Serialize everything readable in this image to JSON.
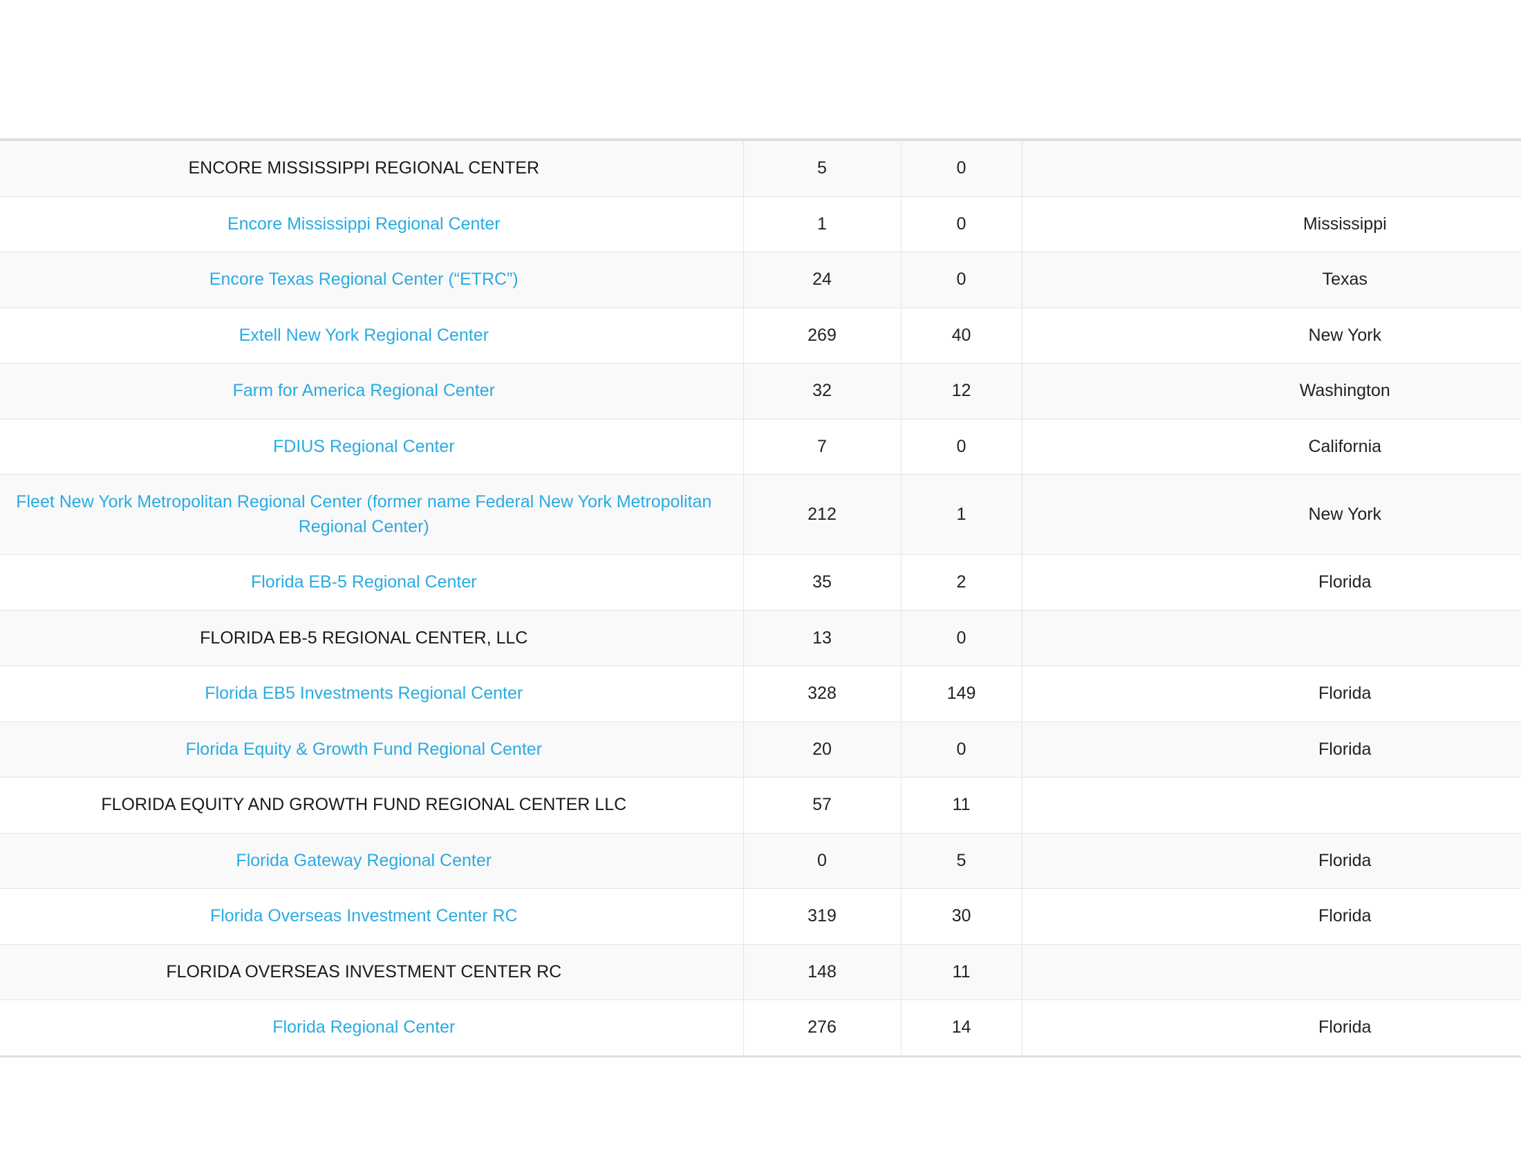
{
  "table": {
    "columns": [
      {
        "key": "name",
        "align": "center"
      },
      {
        "key": "col_a",
        "align": "center"
      },
      {
        "key": "col_b",
        "align": "center"
      },
      {
        "key": "state",
        "align": "center"
      }
    ],
    "accent_link_color": "#29abe2",
    "stripe_color": "#f9f9f9",
    "border_color": "#e4e4e4",
    "rows": [
      {
        "name": "ENCORE MISSISSIPPI REGIONAL CENTER",
        "is_link": false,
        "col_a": "5",
        "col_b": "0",
        "state": ""
      },
      {
        "name": "Encore Mississippi Regional Center",
        "is_link": true,
        "col_a": "1",
        "col_b": "0",
        "state": "Mississippi"
      },
      {
        "name": "Encore Texas Regional Center (“ETRC”)",
        "is_link": true,
        "col_a": "24",
        "col_b": "0",
        "state": "Texas"
      },
      {
        "name": "Extell New York Regional Center",
        "is_link": true,
        "col_a": "269",
        "col_b": "40",
        "state": "New York"
      },
      {
        "name": "Farm for America Regional Center",
        "is_link": true,
        "col_a": "32",
        "col_b": "12",
        "state": "Washington"
      },
      {
        "name": "FDIUS Regional Center",
        "is_link": true,
        "col_a": "7",
        "col_b": "0",
        "state": "California"
      },
      {
        "name": "Fleet New York Metropolitan Regional Center (former name Federal New York Metropolitan Regional Center)",
        "is_link": true,
        "col_a": "212",
        "col_b": "1",
        "state": "New York"
      },
      {
        "name": "Florida EB-5 Regional Center",
        "is_link": true,
        "col_a": "35",
        "col_b": "2",
        "state": "Florida"
      },
      {
        "name": "FLORIDA EB-5 REGIONAL CENTER, LLC",
        "is_link": false,
        "col_a": "13",
        "col_b": "0",
        "state": ""
      },
      {
        "name": "Florida EB5 Investments Regional Center",
        "is_link": true,
        "col_a": "328",
        "col_b": "149",
        "state": "Florida"
      },
      {
        "name": "Florida Equity & Growth Fund Regional Center",
        "is_link": true,
        "col_a": "20",
        "col_b": "0",
        "state": "Florida"
      },
      {
        "name": "FLORIDA EQUITY AND GROWTH FUND REGIONAL CENTER LLC",
        "is_link": false,
        "col_a": "57",
        "col_b": "11",
        "state": ""
      },
      {
        "name": "Florida Gateway Regional Center",
        "is_link": true,
        "col_a": "0",
        "col_b": "5",
        "state": "Florida"
      },
      {
        "name": "Florida Overseas Investment Center RC",
        "is_link": true,
        "col_a": "319",
        "col_b": "30",
        "state": "Florida"
      },
      {
        "name": "FLORIDA OVERSEAS INVESTMENT CENTER RC",
        "is_link": false,
        "col_a": "148",
        "col_b": "11",
        "state": ""
      },
      {
        "name": "Florida Regional Center",
        "is_link": true,
        "col_a": "276",
        "col_b": "14",
        "state": "Florida"
      }
    ]
  }
}
